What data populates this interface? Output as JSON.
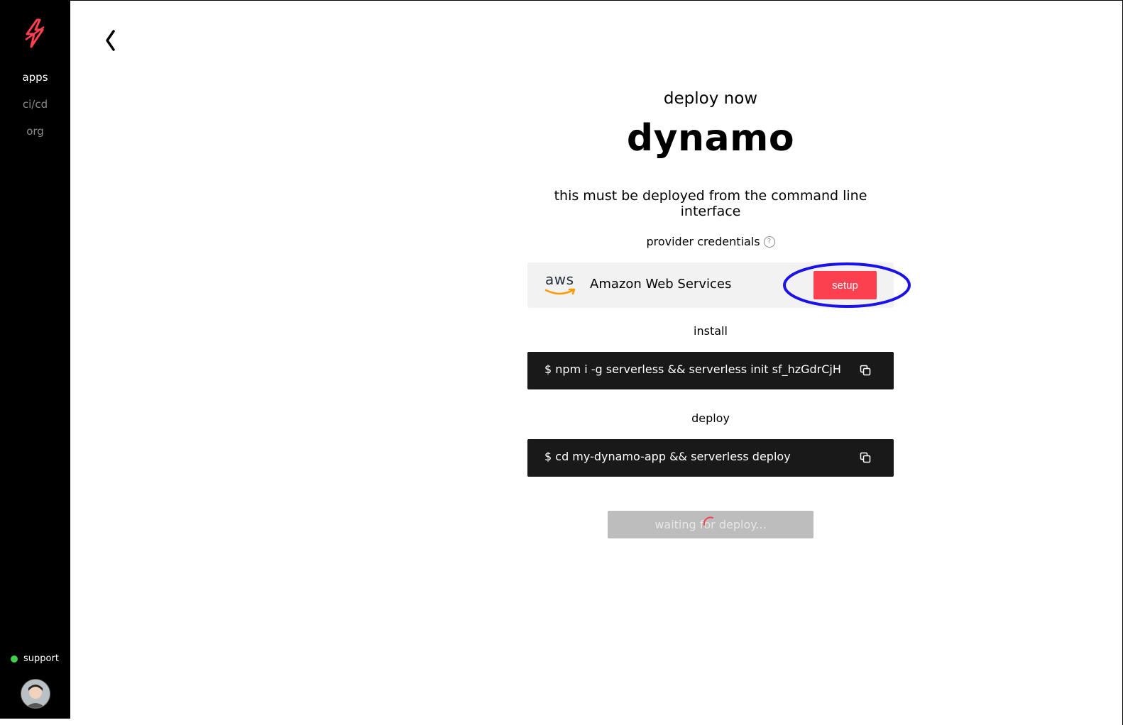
{
  "sidebar": {
    "nav": [
      {
        "label": "apps",
        "active": true
      },
      {
        "label": "ci/cd",
        "active": false
      },
      {
        "label": "org",
        "active": false
      }
    ],
    "support_label": "support",
    "status_color": "#3ecf4b"
  },
  "header": {
    "subtitle": "deploy now",
    "app_name": "dynamo",
    "notice": "this must be deployed from the command line interface"
  },
  "credentials": {
    "label": "provider credentials",
    "help_icon": "question-circle-icon",
    "provider_logo_text": "aws",
    "provider_name": "Amazon Web Services",
    "setup_label": "setup",
    "accent_color": "#fd4050"
  },
  "install": {
    "label": "install",
    "command": "$  npm i -g serverless && serverless init sf_hzGdrCjH",
    "copy_icon": "copy-icon"
  },
  "deploy": {
    "label": "deploy",
    "command": "$  cd my-dynamo-app && serverless deploy",
    "copy_icon": "copy-icon"
  },
  "status": {
    "waiting_label": "waiting for deploy..."
  }
}
